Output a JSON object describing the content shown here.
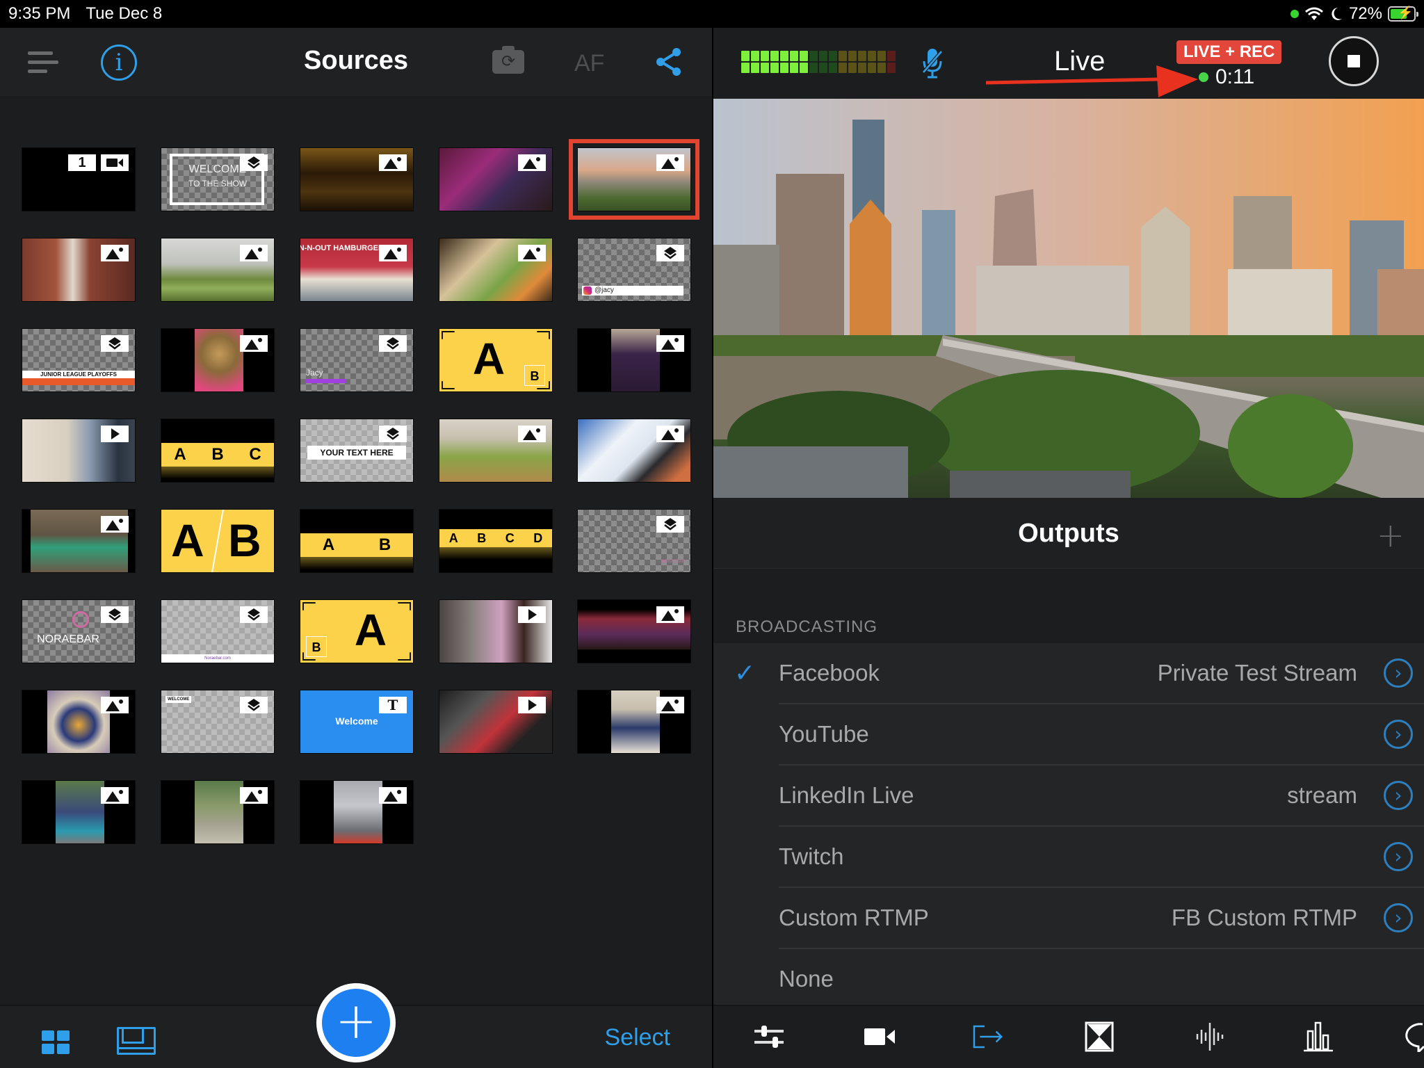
{
  "status_bar": {
    "time": "9:35 PM",
    "date": "Tue Dec 8",
    "battery": "72%",
    "battery_level": 0.72,
    "icons": [
      "green-dot-icon",
      "wifi-icon",
      "moon-icon",
      "battery-charging-icon"
    ]
  },
  "sources_panel": {
    "title": "Sources",
    "af_label": "AF",
    "icons": [
      "hamburger-menu-icon",
      "info-icon",
      "camera-flip-icon",
      "share-icon"
    ],
    "thumbnails": [
      {
        "kind": "camera",
        "number": "1",
        "badge": "video-camera-icon"
      },
      {
        "kind": "overlay",
        "badge": "layers-icon",
        "text_line1": "WELCOME",
        "text_line2": "TO THE SHOW"
      },
      {
        "kind": "image",
        "badge": "image-icon",
        "subject": "dark venue"
      },
      {
        "kind": "image",
        "badge": "image-icon",
        "subject": "concert crowd"
      },
      {
        "kind": "image",
        "badge": "image-icon",
        "subject": "austin skyline",
        "selected": true
      },
      {
        "kind": "image",
        "badge": "image-icon",
        "subject": "brick building"
      },
      {
        "kind": "image",
        "badge": "image-icon",
        "subject": "wetland"
      },
      {
        "kind": "image",
        "badge": "image-icon",
        "subject": "in-n-out",
        "text": "IN-N-OUT HAMBURGERS"
      },
      {
        "kind": "image",
        "badge": "image-icon",
        "subject": "food platter"
      },
      {
        "kind": "overlay",
        "badge": "layers-icon",
        "text": "@jacy"
      },
      {
        "kind": "overlay",
        "badge": "layers-icon",
        "text": "JUNIOR LEAGUE PLAYOFFS"
      },
      {
        "kind": "image",
        "badge": "image-icon",
        "subject": "trophy"
      },
      {
        "kind": "overlay",
        "badge": "layers-icon",
        "text": "Jacy"
      },
      {
        "kind": "layout",
        "text_big": "A",
        "text_small": "B"
      },
      {
        "kind": "image",
        "badge": "image-icon",
        "subject": "purple bag"
      },
      {
        "kind": "video",
        "badge": "play-icon",
        "subject": "presenter"
      },
      {
        "kind": "layout-strip",
        "letters": [
          "A",
          "B",
          "C"
        ]
      },
      {
        "kind": "overlay",
        "badge": "layers-icon",
        "text": "YOUR TEXT HERE"
      },
      {
        "kind": "image",
        "badge": "image-icon",
        "subject": "avocado toast"
      },
      {
        "kind": "image",
        "badge": "image-icon",
        "subject": "snow slope"
      },
      {
        "kind": "image",
        "badge": "image-icon",
        "subject": "couple on stairs"
      },
      {
        "kind": "layout-split",
        "letters": [
          "A",
          "B"
        ]
      },
      {
        "kind": "layout-strip",
        "letters": [
          "A",
          "B"
        ]
      },
      {
        "kind": "layout-strip",
        "letters": [
          "A",
          "B",
          "C",
          "D"
        ]
      },
      {
        "kind": "overlay",
        "badge": "layers-icon",
        "text": "NORAEBAR"
      },
      {
        "kind": "overlay",
        "badge": "layers-icon",
        "text": "NORAEBAR"
      },
      {
        "kind": "overlay",
        "badge": "layers-icon",
        "text": "Noraebar.com"
      },
      {
        "kind": "layout",
        "text_big": "A",
        "text_small": "B",
        "inset_left": true
      },
      {
        "kind": "video",
        "badge": "play-icon",
        "subject": "hallway"
      },
      {
        "kind": "image",
        "badge": "image-icon",
        "subject": "party crowd"
      },
      {
        "kind": "image",
        "badge": "image-icon",
        "subject": "queso dip"
      },
      {
        "kind": "overlay",
        "badge": "layers-icon",
        "text": "WELCOME"
      },
      {
        "kind": "title",
        "badge": "text-icon",
        "text": "Welcome"
      },
      {
        "kind": "video",
        "badge": "play-icon",
        "subject": "app screenshot"
      },
      {
        "kind": "image",
        "badge": "image-icon",
        "subject": "family photo"
      },
      {
        "kind": "image",
        "badge": "image-icon",
        "subject": "mother and child"
      },
      {
        "kind": "image",
        "badge": "image-icon",
        "subject": "park shadow"
      },
      {
        "kind": "image",
        "badge": "image-icon",
        "subject": "graffiti wall"
      }
    ],
    "footer": {
      "select_label": "Select",
      "icons": [
        "grid-view-icon",
        "layout-view-icon",
        "add-icon"
      ]
    }
  },
  "live_panel": {
    "title": "Live",
    "badge": "LIVE + REC",
    "timer": "0:11",
    "audio_meter": {
      "segments": 16,
      "lit": 7
    },
    "mic_muted": true,
    "preview_subject": "Austin skyline over river bridge at sunset",
    "outputs": {
      "title": "Outputs",
      "section": "BROADCASTING",
      "rows": [
        {
          "name": "Facebook",
          "detail": "Private Test Stream",
          "checked": true
        },
        {
          "name": "YouTube",
          "detail": "",
          "checked": false
        },
        {
          "name": "LinkedIn Live",
          "detail": "stream",
          "checked": false
        },
        {
          "name": "Twitch",
          "detail": "",
          "checked": false
        },
        {
          "name": "Custom RTMP",
          "detail": "FB Custom RTMP",
          "checked": false
        },
        {
          "name": "None",
          "detail": "",
          "checked": false,
          "no_chevron": true
        }
      ]
    },
    "toolbar": {
      "tabs": [
        "settings-sliders-icon",
        "camera-icon",
        "output-icon",
        "transition-icon",
        "audio-icon",
        "stats-icon",
        "comments-icon"
      ],
      "active": "output-icon"
    }
  },
  "colors": {
    "accent_blue": "#2e9fe8",
    "live_red": "#e3463a",
    "selection_red": "#e2452f",
    "meter_green": "#7ef03c",
    "status_green": "#47d34a",
    "layout_yellow": "#fbd24a"
  }
}
